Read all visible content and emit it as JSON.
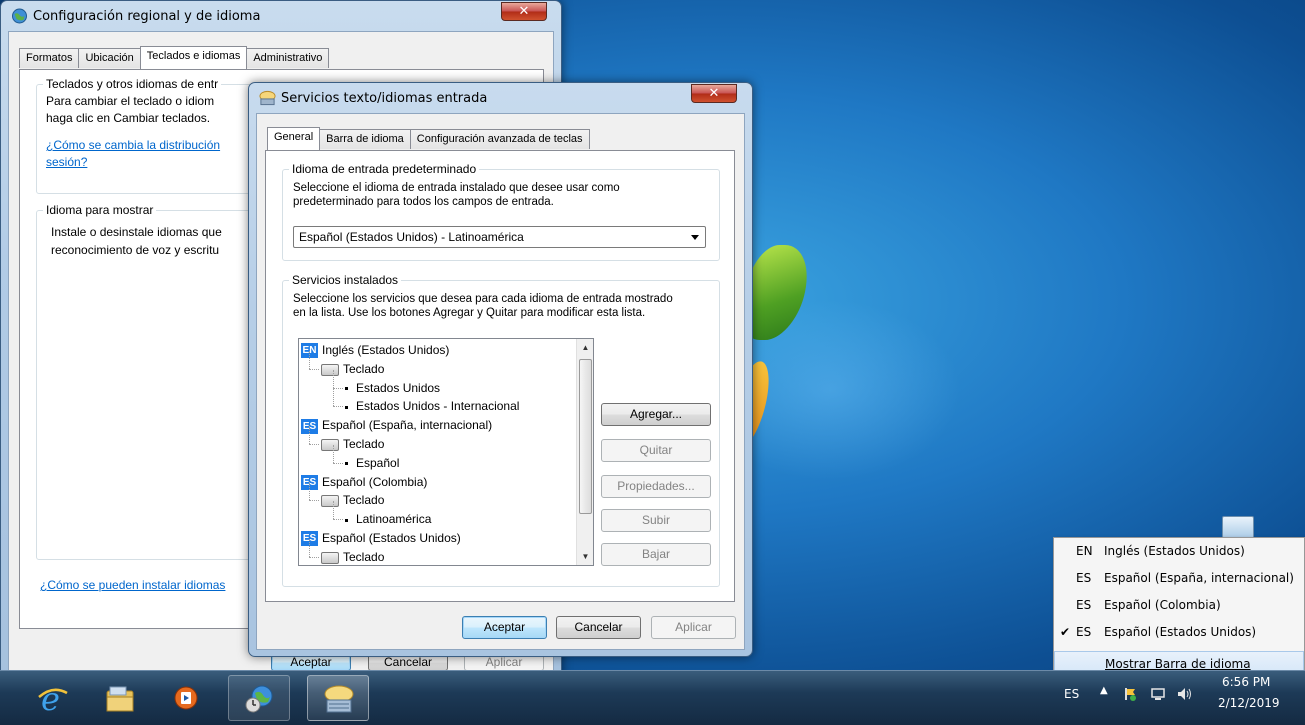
{
  "back_window": {
    "title": "Configuración regional y de idioma",
    "close": "✕",
    "tabs": [
      "Formatos",
      "Ubicación",
      "Teclados e idiomas",
      "Administrativo"
    ],
    "active_tab": 2,
    "group1_title": "Teclados y otros idiomas de entr",
    "group1_text_1": "Para cambiar el teclado o idiom",
    "group1_text_2": "haga clic en Cambiar teclados.",
    "group1_link_1": "¿Cómo se cambia la distribución",
    "group1_link_2": "sesión?",
    "group2_title": "Idioma para mostrar",
    "group2_text_1": "Instale o desinstale idiomas que",
    "group2_text_2": "reconocimiento de voz y escritu",
    "install_link": "¿Cómo se pueden instalar idiomas",
    "buttons": {
      "ok": "Aceptar",
      "cancel": "Cancelar",
      "apply": "Aplicar"
    }
  },
  "dialog": {
    "title": "Servicios texto/idiomas entrada",
    "close": "✕",
    "tabs": [
      "General",
      "Barra de idioma",
      "Configuración avanzada de teclas"
    ],
    "active_tab": 0,
    "default_group": {
      "title": "Idioma de entrada predeterminado",
      "desc_1": "Seleccione el idioma de entrada instalado que desee usar como",
      "desc_2": "predeterminado para todos los campos de entrada.",
      "selected": "Español (Estados Unidos) - Latinoamérica"
    },
    "services_group": {
      "title": "Servicios instalados",
      "desc_1": "Seleccione los servicios que desea para cada idioma de entrada mostrado",
      "desc_2": "en la lista. Use los botones Agregar y Quitar para modificar esta lista.",
      "tree": [
        {
          "kind": "lang",
          "code": "EN",
          "text": "Inglés (Estados Unidos)"
        },
        {
          "kind": "kb",
          "text": "Teclado"
        },
        {
          "kind": "layout",
          "text": "Estados Unidos"
        },
        {
          "kind": "layout",
          "text": "Estados Unidos - Internacional"
        },
        {
          "kind": "lang",
          "code": "ES",
          "text": "Español (España, internacional)"
        },
        {
          "kind": "kb",
          "text": "Teclado"
        },
        {
          "kind": "layout",
          "text": "Español"
        },
        {
          "kind": "lang",
          "code": "ES",
          "text": "Español (Colombia)"
        },
        {
          "kind": "kb",
          "text": "Teclado"
        },
        {
          "kind": "layout",
          "text": "Latinoamérica"
        },
        {
          "kind": "lang",
          "code": "ES",
          "text": "Español (Estados Unidos)"
        },
        {
          "kind": "kb",
          "text": "Teclado"
        }
      ],
      "buttons": {
        "add": "Agregar...",
        "remove": "Quitar",
        "properties": "Propiedades...",
        "up": "Subir",
        "down": "Bajar"
      }
    },
    "footer": {
      "ok": "Aceptar",
      "cancel": "Cancelar",
      "apply": "Aplicar"
    }
  },
  "language_menu": {
    "items": [
      {
        "code": "EN",
        "name": "Inglés (Estados Unidos)",
        "checked": false
      },
      {
        "code": "ES",
        "name": "Español (España, internacional)",
        "checked": false
      },
      {
        "code": "ES",
        "name": "Español (Colombia)",
        "checked": false
      },
      {
        "code": "ES",
        "name": "Español (Estados Unidos)",
        "checked": true
      }
    ],
    "show_bar": "Mostrar Barra de idioma"
  },
  "taskbar": {
    "items": [
      "internet-explorer-icon",
      "folder-icon",
      "media-player-icon",
      "network-globe-icon",
      "language-services-icon"
    ],
    "tray": {
      "lang": "ES",
      "time": "6:56 PM",
      "date": "2/12/2019"
    }
  }
}
